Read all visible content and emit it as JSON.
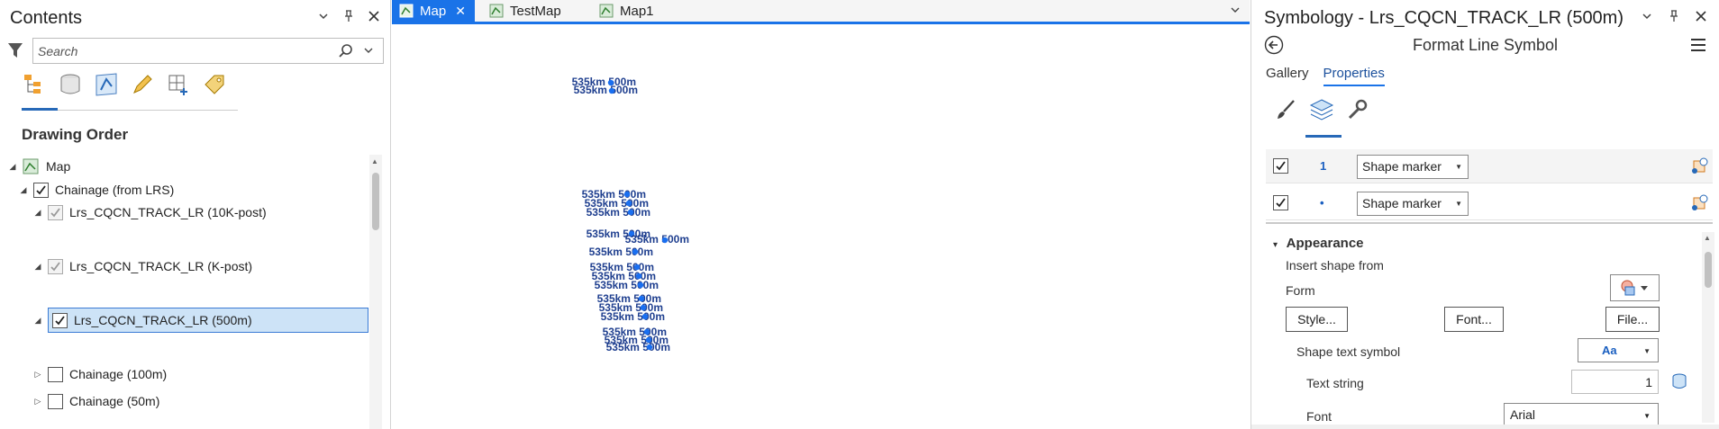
{
  "contents": {
    "title": "Contents",
    "search_placeholder": "Search",
    "section_title": "Drawing Order",
    "tree": [
      {
        "label": "Map",
        "checked": null
      },
      {
        "label": "Chainage (from LRS)",
        "checked": true
      },
      {
        "label": "Lrs_CQCN_TRACK_LR (10K-post)",
        "checked": true
      },
      {
        "label": "Lrs_CQCN_TRACK_LR (K-post)",
        "checked": true
      },
      {
        "label": "Lrs_CQCN_TRACK_LR (500m)",
        "checked": true
      },
      {
        "label": "Chainage (100m)",
        "checked": false
      },
      {
        "label": "Chainage (50m)",
        "checked": false
      }
    ]
  },
  "map": {
    "tabs": [
      {
        "label": "Map",
        "active": true
      },
      {
        "label": "TestMap",
        "active": false
      },
      {
        "label": "Map1",
        "active": false
      }
    ],
    "label_text": "535km 500m",
    "label_color": "#1f3f8f",
    "point_color": "#1a6ff0"
  },
  "symbology": {
    "title": "Symbology - Lrs_CQCN_TRACK_LR (500m)",
    "subtitle": "Format Line Symbol",
    "tabs": [
      "Gallery",
      "Properties"
    ],
    "layers": [
      {
        "index": "1",
        "type": "Shape marker"
      },
      {
        "index": "•",
        "type": "Shape marker"
      }
    ],
    "appearance": "Appearance",
    "insert_shape_from": "Insert shape from",
    "form_label": "Form",
    "buttons": {
      "style": "Style...",
      "font": "Font...",
      "file": "File..."
    },
    "shape_text_symbol": "Shape text symbol",
    "aa_label": "Aa",
    "text_string_label": "Text string",
    "text_string_value": "1",
    "font_label": "Font",
    "font_value": "Arial"
  }
}
